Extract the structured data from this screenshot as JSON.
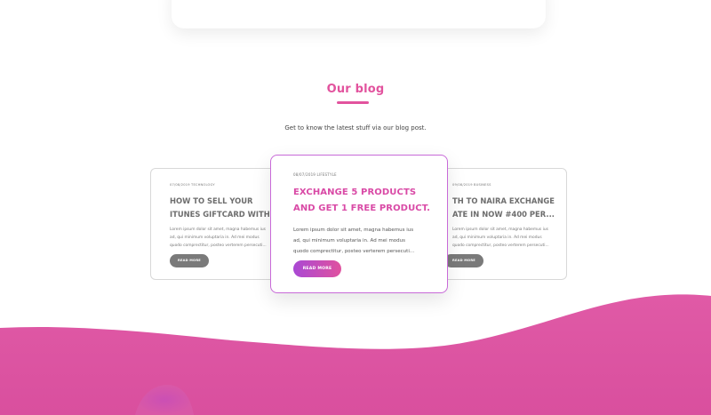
{
  "blog": {
    "title": "Our blog",
    "subtitle": "Get to know the latest stuff via our blog post.",
    "posts": [
      {
        "meta": "07/08/2019 TECHNOLOGY",
        "title_line1": "HOW TO SELL YOUR",
        "title_line2": "ITUNES GIFTCARD WITH...",
        "excerpt_line1": "Lorem ipsum dolor sit amet, magna habemus ius",
        "excerpt_line2": "ad, qui minimum voluptaria in. Ad mei modus",
        "excerpt_line3": "quodo comprectitur, posteo verterem persecuti...",
        "button": "READ MORE"
      },
      {
        "meta": "08/07/2019 LIFESTYLE",
        "title_line1": "EXCHANGE 5 PRODUCTS",
        "title_line2": "AND GET 1 FREE PRODUCT.",
        "excerpt_line1": "Lorem ipsum dolor sit amet, magna habemus ius",
        "excerpt_line2": "ad, qui minimum voluptaria in. Ad mei modus",
        "excerpt_line3": "quodo comprectitur, posteo verterem persecuti...",
        "button": "READ MORE"
      },
      {
        "meta": "09/08/2019 BUSINESS",
        "title_line1": "TH TO NAIRA EXCHANGE",
        "title_line2": "ATE IN NOW #400 PER...",
        "excerpt_line1": "Lorem ipsum dolor sit amet, magna habemus ius",
        "excerpt_line2": "ad, qui minimum voluptaria in. Ad mei modus",
        "excerpt_line3": "quodo comprectitur, posteo verterem persecuti...",
        "button": "READ MORE"
      }
    ]
  },
  "colors": {
    "accent": "#e2539e",
    "gradient_start": "#a948d4",
    "gradient_end": "#e0529f",
    "muted_button": "#7a7a7a"
  }
}
